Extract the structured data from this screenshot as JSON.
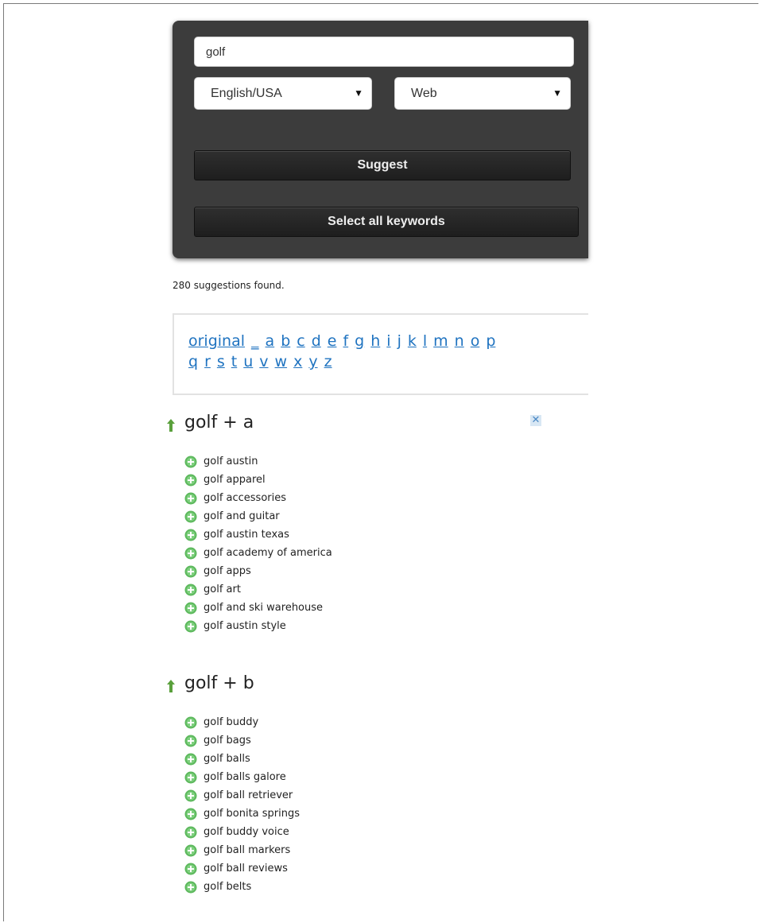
{
  "search": {
    "query": "golf",
    "language": "English/USA",
    "source": "Web"
  },
  "buttons": {
    "suggest": "Suggest",
    "select_all": "Select all keywords"
  },
  "results": {
    "count_text": "280 suggestions found."
  },
  "letter_nav": {
    "row1": [
      "original",
      "_",
      "a",
      "b",
      "c",
      "d",
      "e",
      "f",
      "g",
      "h",
      "i",
      "j",
      "k",
      "l",
      "m",
      "n",
      "o",
      "p"
    ],
    "row2": [
      "q",
      "r",
      "s",
      "t",
      "u",
      "v",
      "w",
      "x",
      "y",
      "z"
    ]
  },
  "ad": {
    "close_symbol": "✕"
  },
  "sections": [
    {
      "title": "golf + a",
      "keywords": [
        "golf austin",
        "golf apparel",
        "golf accessories",
        "golf and guitar",
        "golf austin texas",
        "golf academy of america",
        "golf apps",
        "golf art",
        "golf and ski warehouse",
        "golf austin style"
      ]
    },
    {
      "title": "golf + b",
      "keywords": [
        "golf buddy",
        "golf bags",
        "golf balls",
        "golf balls galore",
        "golf ball retriever",
        "golf bonita springs",
        "golf buddy voice",
        "golf ball markers",
        "golf ball reviews",
        "golf belts"
      ]
    }
  ],
  "icons": {
    "up": "up-arrow-icon",
    "add": "plus-circle-icon",
    "close": "close-icon"
  },
  "colors": {
    "panel": "#3c3c3c",
    "link": "#1f73c0",
    "add_icon": "#5cb85c",
    "up_arrow": "#5aa03c"
  }
}
